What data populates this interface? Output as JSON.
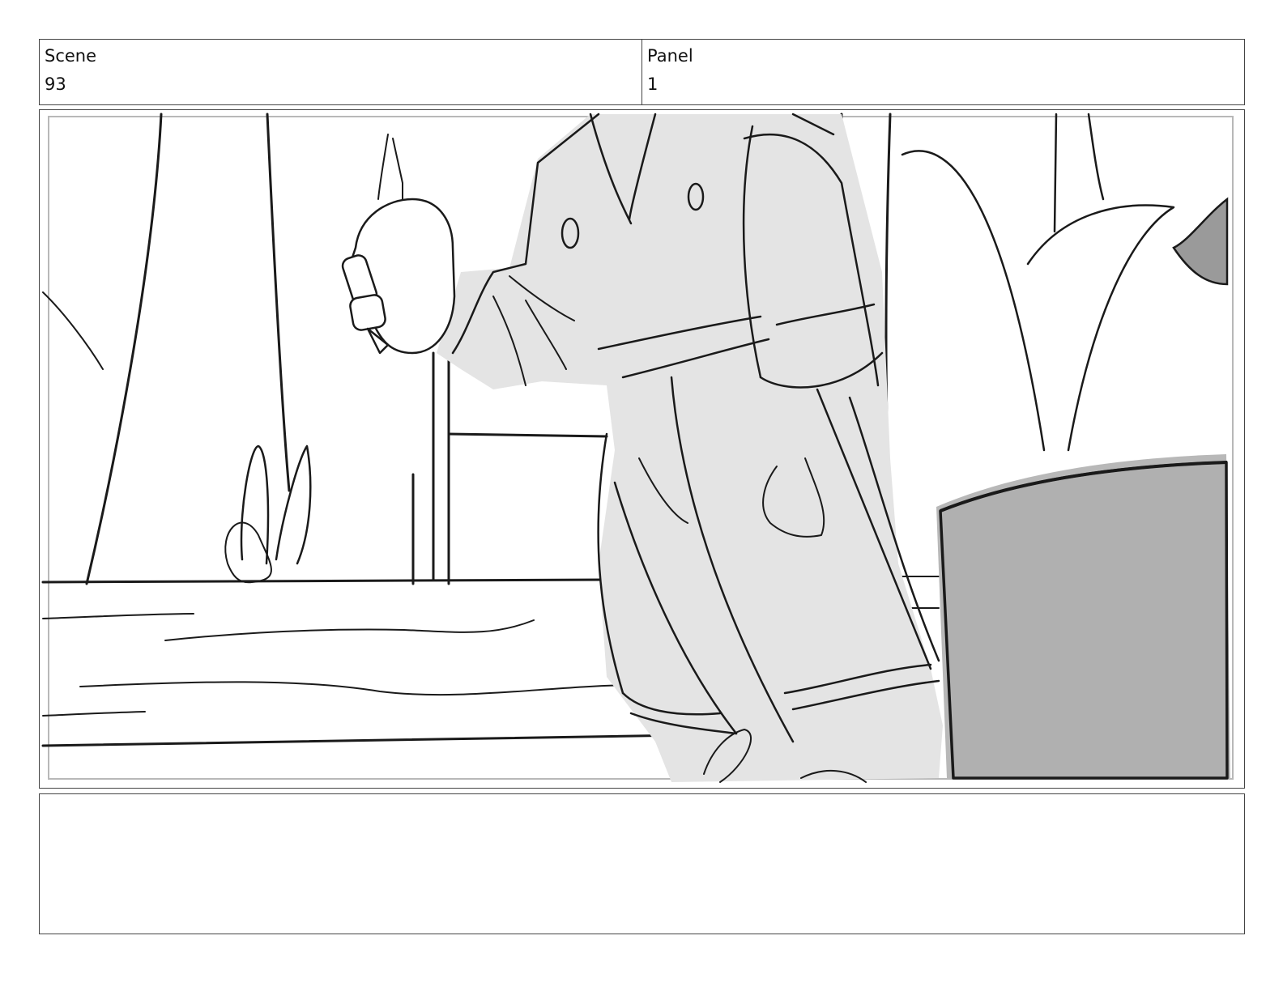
{
  "header": {
    "scene_label": "Scene",
    "scene_value": "93",
    "panel_label": "Panel",
    "panel_value": "1"
  },
  "panel_image": {
    "description_icon": "storyboard-sketch",
    "colors": {
      "line": "#1a1a1a",
      "robe_fill": "#e4e4e4",
      "chair_fill": "#b0b0b0",
      "inner_border": "#b8b8b8"
    }
  },
  "notes": {
    "text": ""
  }
}
